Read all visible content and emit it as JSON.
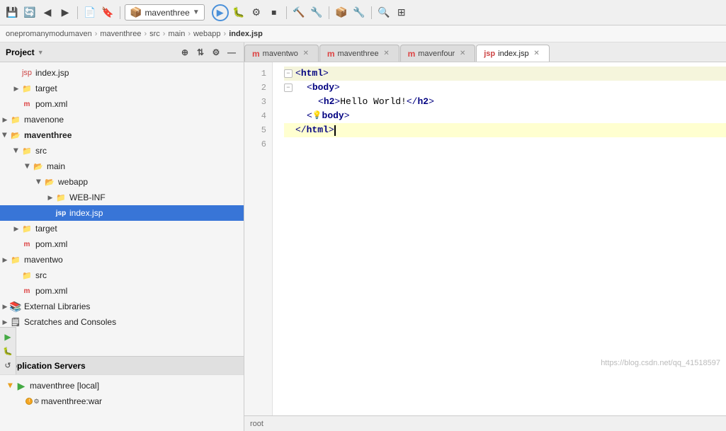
{
  "toolbar": {
    "project_dropdown": "maventhree",
    "run_label": "▶",
    "buttons": [
      "undo",
      "redo",
      "back",
      "forward",
      "open",
      "bookmark",
      "run",
      "debug",
      "run-config",
      "stop",
      "build",
      "rebuild",
      "maven",
      "settings",
      "search",
      "unknown"
    ]
  },
  "breadcrumb": {
    "items": [
      "onepromanymodumaven",
      "maventhree",
      "src",
      "main",
      "webapp",
      "index.jsp"
    ]
  },
  "sidebar": {
    "title": "Project",
    "tree": [
      {
        "id": "index-jsp-root",
        "label": "index.jsp",
        "indent": 1,
        "icon": "jsp",
        "expanded": false,
        "arrow": "hidden"
      },
      {
        "id": "target-root",
        "label": "target",
        "indent": 1,
        "icon": "folder",
        "expanded": false,
        "arrow": "right"
      },
      {
        "id": "pom-root",
        "label": "pom.xml",
        "indent": 1,
        "icon": "pom",
        "expanded": false,
        "arrow": "hidden"
      },
      {
        "id": "mavenone",
        "label": "mavenone",
        "indent": 0,
        "icon": "folder",
        "expanded": false,
        "arrow": "right"
      },
      {
        "id": "maventhree",
        "label": "maventhree",
        "indent": 0,
        "icon": "folder",
        "expanded": true,
        "arrow": "open",
        "selected": false
      },
      {
        "id": "src",
        "label": "src",
        "indent": 1,
        "icon": "folder",
        "expanded": true,
        "arrow": "open"
      },
      {
        "id": "main",
        "label": "main",
        "indent": 2,
        "icon": "folder",
        "expanded": true,
        "arrow": "open"
      },
      {
        "id": "webapp",
        "label": "webapp",
        "indent": 3,
        "icon": "folder",
        "expanded": true,
        "arrow": "open"
      },
      {
        "id": "web-inf",
        "label": "WEB-INF",
        "indent": 4,
        "icon": "folder",
        "expanded": false,
        "arrow": "right"
      },
      {
        "id": "index-jsp",
        "label": "index.jsp",
        "indent": 4,
        "icon": "jsp",
        "expanded": false,
        "arrow": "hidden",
        "selected": true
      },
      {
        "id": "target",
        "label": "target",
        "indent": 1,
        "icon": "folder",
        "expanded": false,
        "arrow": "right"
      },
      {
        "id": "pom",
        "label": "pom.xml",
        "indent": 1,
        "icon": "pom",
        "expanded": false,
        "arrow": "hidden"
      },
      {
        "id": "maventwo",
        "label": "maventwo",
        "indent": 0,
        "icon": "folder",
        "expanded": false,
        "arrow": "right"
      },
      {
        "id": "src2",
        "label": "src",
        "indent": 1,
        "icon": "folder",
        "expanded": false,
        "arrow": "hidden"
      },
      {
        "id": "pom2",
        "label": "pom.xml",
        "indent": 1,
        "icon": "pom",
        "expanded": false,
        "arrow": "hidden"
      },
      {
        "id": "ext-libs",
        "label": "External Libraries",
        "indent": 0,
        "icon": "external",
        "expanded": false,
        "arrow": "right"
      },
      {
        "id": "scratches",
        "label": "Scratches and Consoles",
        "indent": 0,
        "icon": "scratch",
        "expanded": false,
        "arrow": "right"
      }
    ]
  },
  "app_servers": {
    "title": "Application Servers",
    "items": [
      {
        "id": "maventhree-local",
        "label": "maventhree [local]",
        "indent": 1,
        "icon": "maven",
        "expanded": true,
        "arrow": "open"
      },
      {
        "id": "maventhree-war",
        "label": "maventhree:war",
        "indent": 2,
        "icon": "war",
        "expanded": false,
        "arrow": "hidden"
      }
    ]
  },
  "editor": {
    "tabs": [
      {
        "id": "tab-maventwo",
        "label": "maventwo",
        "icon": "m",
        "active": false
      },
      {
        "id": "tab-maventhree",
        "label": "maventhree",
        "icon": "m",
        "active": false
      },
      {
        "id": "tab-mavenfour",
        "label": "mavenfour",
        "icon": "m",
        "active": false
      },
      {
        "id": "tab-indexjsp",
        "label": "index.jsp",
        "icon": "jsp",
        "active": true
      }
    ],
    "lines": [
      {
        "num": 1,
        "content": "<html>",
        "fold": true,
        "type": "open"
      },
      {
        "num": 2,
        "content": "  <body>",
        "fold": true,
        "type": "open"
      },
      {
        "num": 3,
        "content": "    <h2>Hello World!</h2>",
        "fold": false,
        "type": "content"
      },
      {
        "num": 4,
        "content": "  </body>",
        "fold": false,
        "type": "close"
      },
      {
        "num": 5,
        "content": "</html>",
        "fold": false,
        "type": "close"
      },
      {
        "num": 6,
        "content": "",
        "fold": false,
        "type": "empty"
      }
    ],
    "status": "root"
  },
  "watermark": "https://blog.csdn.net/qq_41518597"
}
